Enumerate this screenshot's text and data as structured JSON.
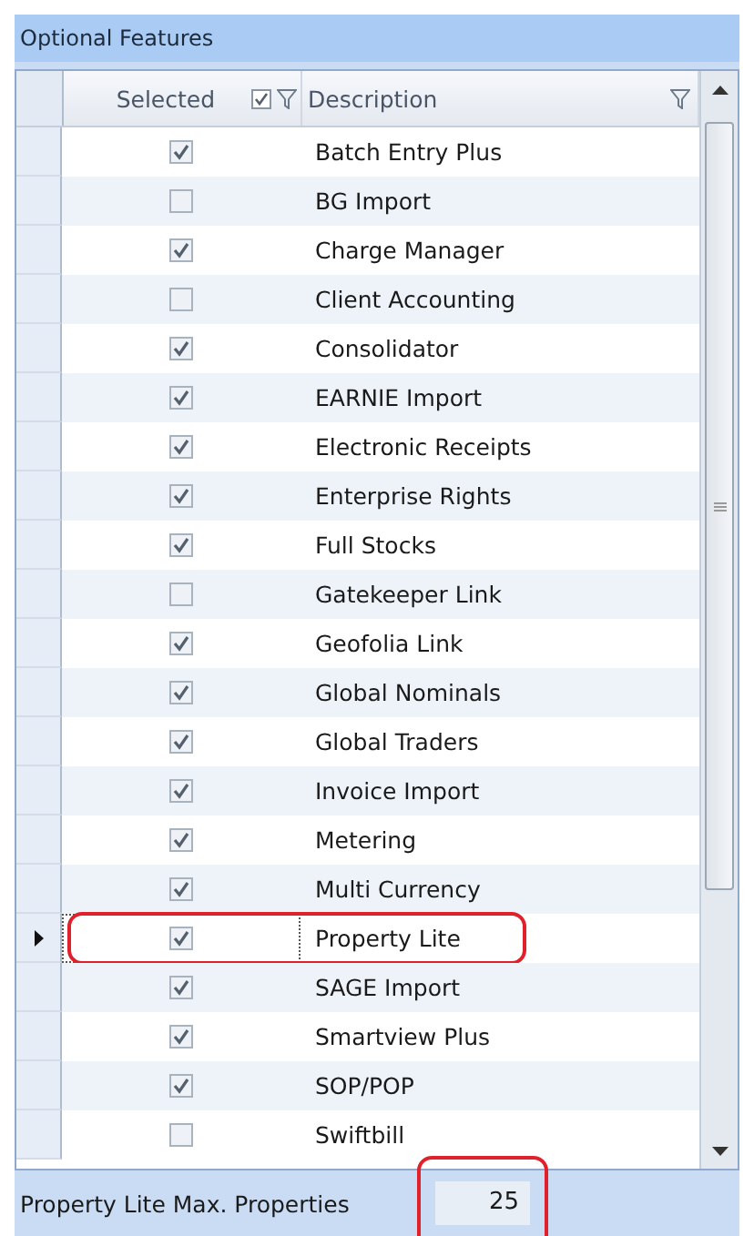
{
  "panel": {
    "title": "Optional Features"
  },
  "grid": {
    "columns": [
      {
        "label": "Selected",
        "kind": "check"
      },
      {
        "label": "Description",
        "kind": "text"
      }
    ],
    "rows": [
      {
        "selected": false,
        "checked": true,
        "description": "Batch Entry Plus",
        "highlighted": false
      },
      {
        "selected": false,
        "checked": false,
        "description": "BG Import",
        "highlighted": false
      },
      {
        "selected": false,
        "checked": true,
        "description": "Charge Manager",
        "highlighted": false
      },
      {
        "selected": false,
        "checked": false,
        "description": "Client Accounting",
        "highlighted": false
      },
      {
        "selected": false,
        "checked": true,
        "description": "Consolidator",
        "highlighted": false
      },
      {
        "selected": false,
        "checked": true,
        "description": "EARNIE Import",
        "highlighted": false
      },
      {
        "selected": false,
        "checked": true,
        "description": "Electronic Receipts",
        "highlighted": false
      },
      {
        "selected": false,
        "checked": true,
        "description": "Enterprise Rights",
        "highlighted": false
      },
      {
        "selected": false,
        "checked": true,
        "description": "Full Stocks",
        "highlighted": false
      },
      {
        "selected": false,
        "checked": false,
        "description": "Gatekeeper Link",
        "highlighted": false
      },
      {
        "selected": false,
        "checked": true,
        "description": "Geofolia Link",
        "highlighted": false
      },
      {
        "selected": false,
        "checked": true,
        "description": "Global Nominals",
        "highlighted": false
      },
      {
        "selected": false,
        "checked": true,
        "description": "Global Traders",
        "highlighted": false
      },
      {
        "selected": false,
        "checked": true,
        "description": "Invoice Import",
        "highlighted": false
      },
      {
        "selected": false,
        "checked": true,
        "description": "Metering",
        "highlighted": false
      },
      {
        "selected": false,
        "checked": true,
        "description": "Multi Currency",
        "highlighted": false
      },
      {
        "selected": true,
        "checked": true,
        "description": "Property Lite",
        "highlighted": true
      },
      {
        "selected": false,
        "checked": true,
        "description": "SAGE Import",
        "highlighted": false
      },
      {
        "selected": false,
        "checked": true,
        "description": "Smartview Plus",
        "highlighted": false
      },
      {
        "selected": false,
        "checked": true,
        "description": "SOP/POP",
        "highlighted": false
      },
      {
        "selected": false,
        "checked": false,
        "description": "Swiftbill",
        "highlighted": false
      }
    ]
  },
  "footer": {
    "label": "Property Lite Max. Properties",
    "value": "25",
    "highlighted": true
  }
}
